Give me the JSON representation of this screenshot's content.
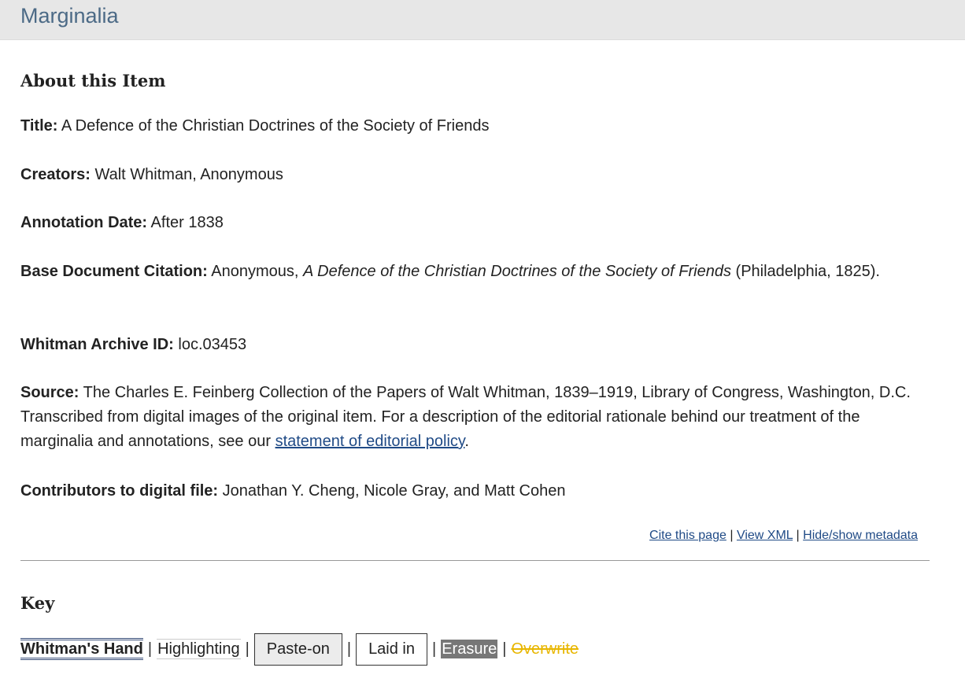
{
  "header": {
    "site_title": "Marginalia"
  },
  "about": {
    "heading": "About this Item",
    "title_label": "Title:",
    "title_value": "A Defence of the Christian Doctrines of the Society of Friends",
    "creators_label": "Creators:",
    "creators_value": "Walt Whitman, Anonymous",
    "date_label": "Annotation Date:",
    "date_value": "After 1838",
    "citation_label": "Base Document Citation:",
    "citation_prefix": "Anonymous,",
    "citation_italic": "A Defence of the Christian Doctrines of the Society of Friends",
    "citation_suffix": "(Philadelphia, 1825).",
    "archive_id_label": "Whitman Archive ID:",
    "archive_id_value": "loc.03453",
    "source_label": "Source:",
    "source_text": "The Charles E. Feinberg Collection of the Papers of Walt Whitman, 1839–1919, Library of Congress, Washington, D.C. Transcribed from digital images of the original item. For a description of the editorial rationale behind our treatment of the marginalia and annotations, see our",
    "source_link": "statement of editorial policy",
    "source_end": ".",
    "contributors_label": "Contributors to digital file:",
    "contributors_value": "Jonathan Y. Cheng, Nicole Gray, and Matt Cohen"
  },
  "actions": {
    "cite": "Cite this page",
    "view_xml": "View XML",
    "toggle_meta": "Hide/show metadata",
    "separator": "|"
  },
  "key": {
    "heading": "Key",
    "whitmans_hand": "Whitman's Hand",
    "highlighting": "Highlighting",
    "paste_on": "Paste-on",
    "laid_in": "Laid in",
    "erasure": "Erasure",
    "overwrite": "Overwrite",
    "separator": "|"
  },
  "colors": {
    "brand": "#4c6a86",
    "link": "#1f4a86",
    "overwrite": "#e8b600",
    "erasure_bg": "#777777"
  }
}
